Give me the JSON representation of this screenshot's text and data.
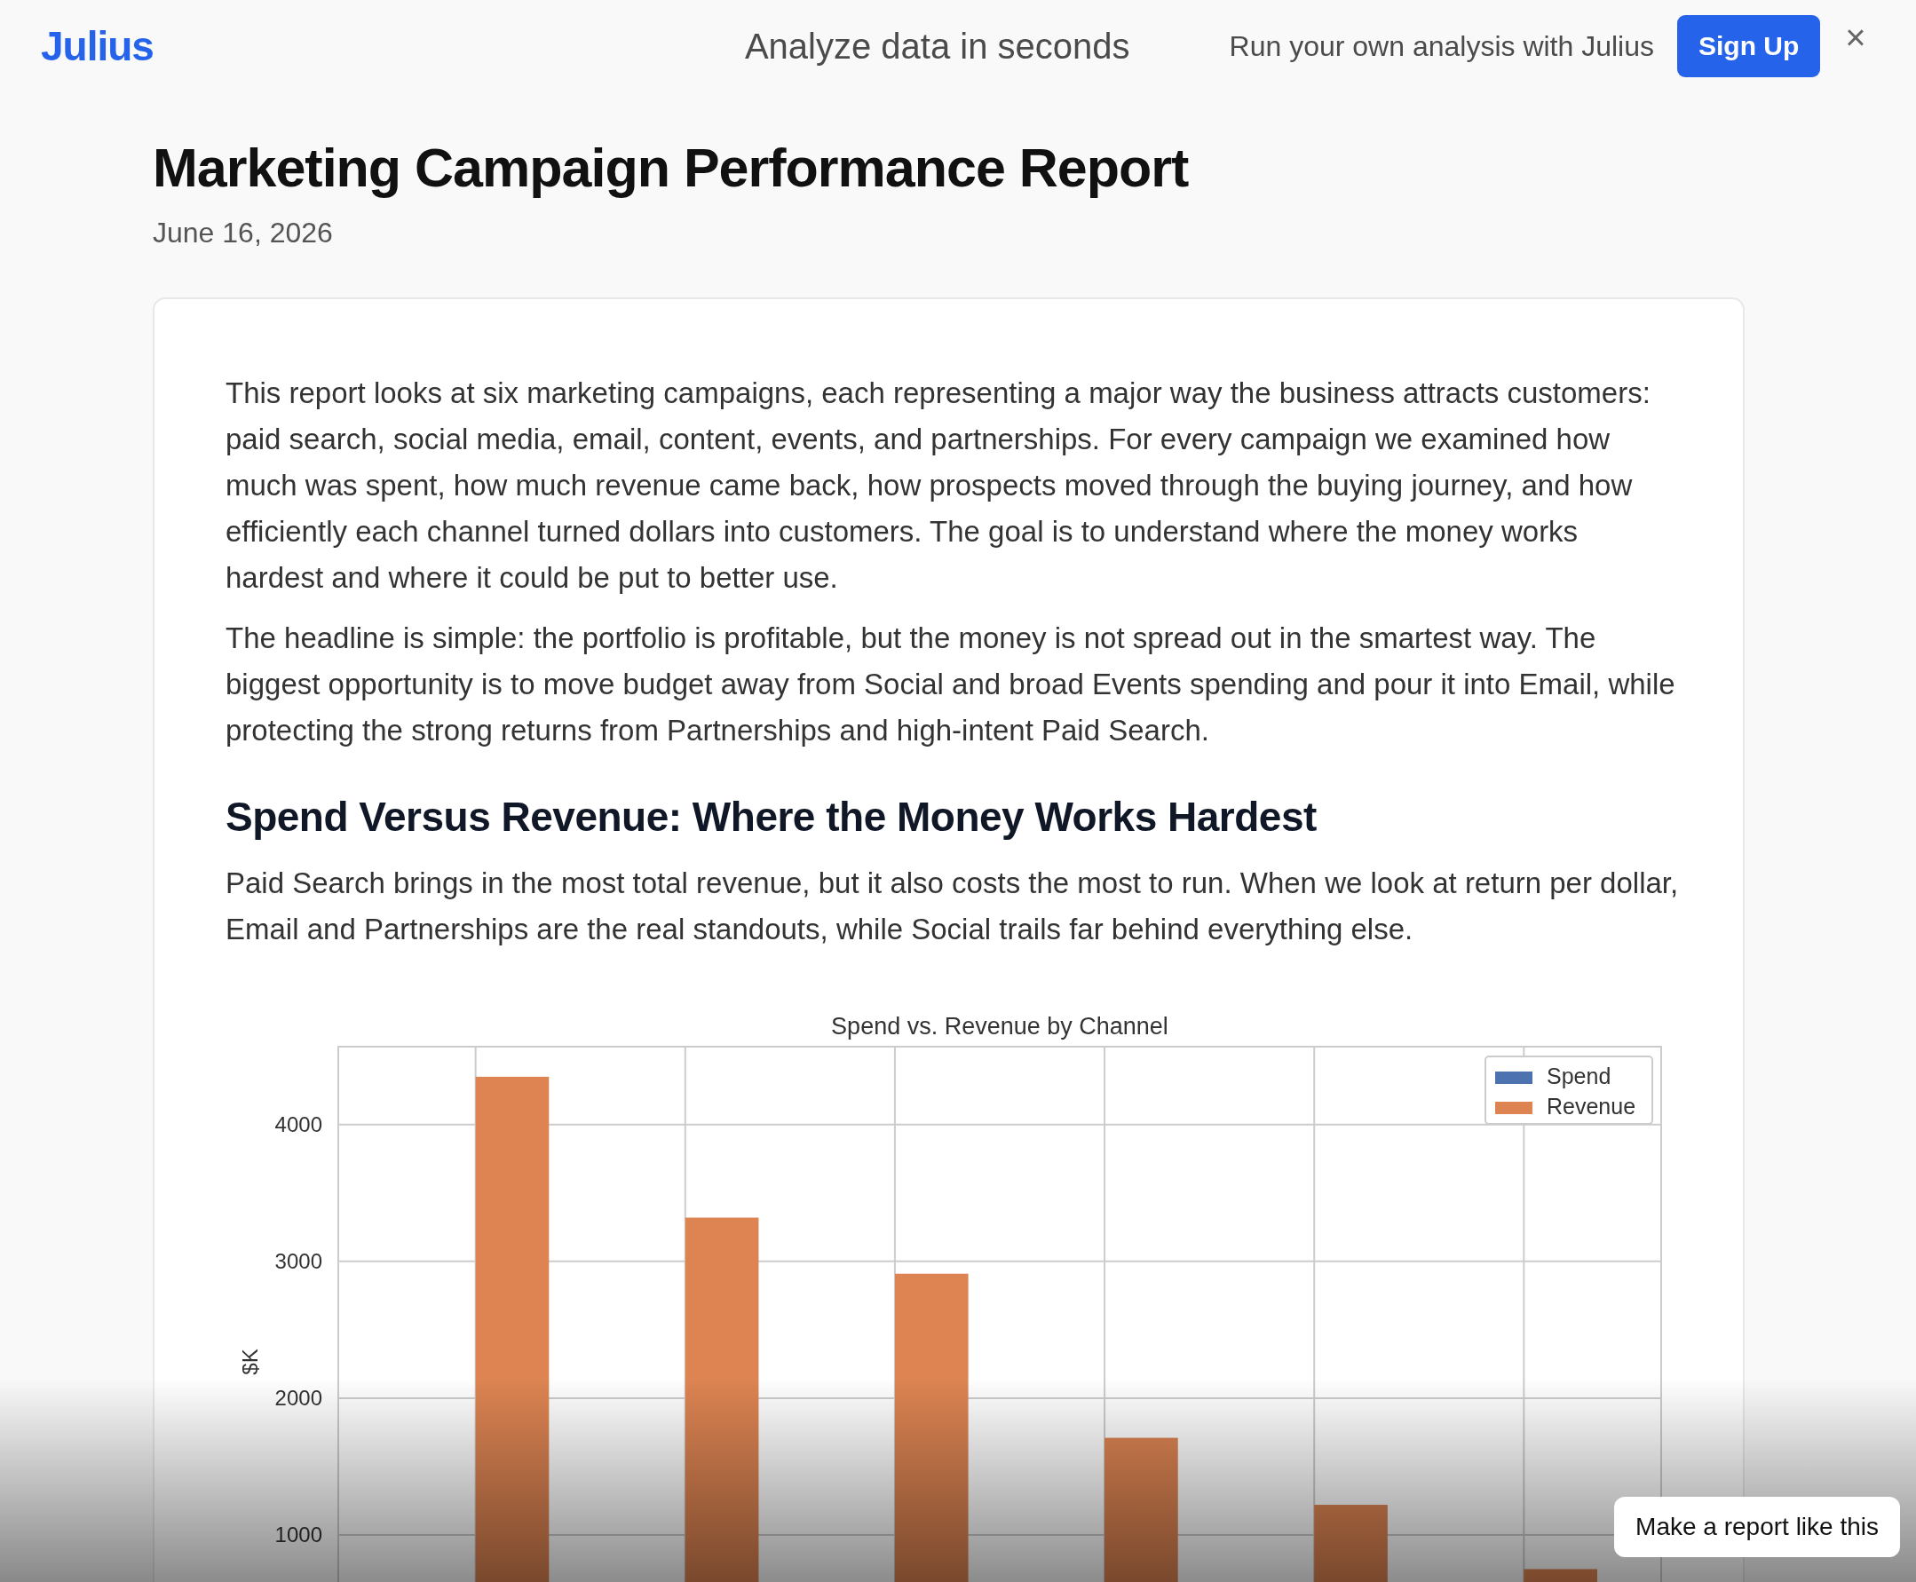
{
  "header": {
    "logo": "Julius",
    "tagline": "Analyze data in seconds",
    "promo": "Run your own analysis with Julius",
    "signup_button": "Sign Up",
    "close_button": "×"
  },
  "report": {
    "title": "Marketing Campaign Performance Report",
    "date": "June 16, 2026",
    "paragraphs": [
      "This report looks at six marketing campaigns, each representing a major way the business attracts customers: paid search, social media, email, content, events, and partnerships. For every campaign we examined how much was spent, how much revenue came back, how prospects moved through the buying journey, and how efficiently each channel turned dollars into customers. The goal is to understand where the money works hardest and where it could be put to better use.",
      "The headline is simple: the portfolio is profitable, but the money is not spread out in the smartest way. The biggest opportunity is to move budget away from Social and broad Events spending and pour it into Email, while protecting the strong returns from Partnerships and high-intent Paid Search."
    ],
    "section_heading": "Spend Versus Revenue: Where the Money Works Hardest",
    "section_text": "Paid Search brings in the most total revenue, but it also costs the most to run. When we look at return per dollar, Email and Partnerships are the real standouts, while Social trails far behind everything else.",
    "chart_data": {
      "type": "bar",
      "grid": true,
      "title": "Spend vs. Revenue by Channel",
      "ylabel": "$K",
      "ylim": [
        0,
        4570
      ],
      "yticks": [
        1000,
        2000,
        3000,
        4000
      ],
      "series": [
        {
          "name": "Spend",
          "color": "#4c72b0",
          "values": [
            null,
            null,
            null,
            null,
            null,
            null
          ]
        },
        {
          "name": "Revenue",
          "color": "#dd8452",
          "values": [
            4350,
            3320,
            2910,
            1710,
            1220,
            750
          ]
        }
      ]
    }
  },
  "cta_button": "Make a report like this"
}
